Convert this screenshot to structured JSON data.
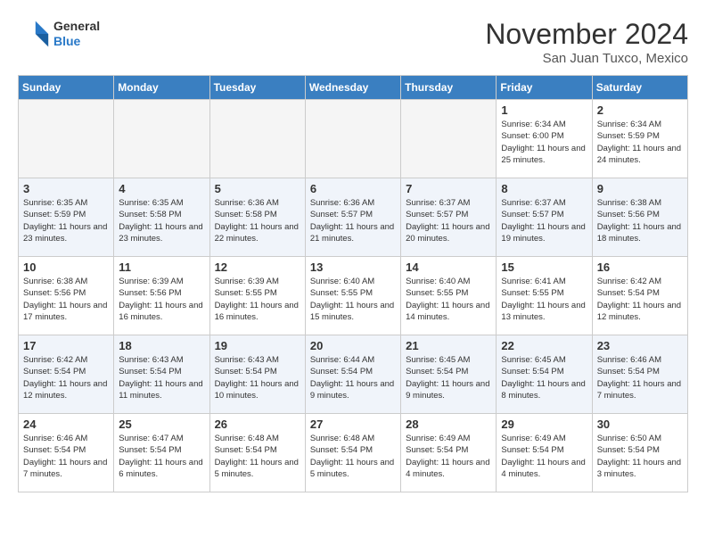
{
  "header": {
    "logo_general": "General",
    "logo_blue": "Blue",
    "month_title": "November 2024",
    "location": "San Juan Tuxco, Mexico"
  },
  "weekdays": [
    "Sunday",
    "Monday",
    "Tuesday",
    "Wednesday",
    "Thursday",
    "Friday",
    "Saturday"
  ],
  "weeks": [
    [
      {
        "day": "",
        "info": ""
      },
      {
        "day": "",
        "info": ""
      },
      {
        "day": "",
        "info": ""
      },
      {
        "day": "",
        "info": ""
      },
      {
        "day": "",
        "info": ""
      },
      {
        "day": "1",
        "info": "Sunrise: 6:34 AM\nSunset: 6:00 PM\nDaylight: 11 hours and 25 minutes."
      },
      {
        "day": "2",
        "info": "Sunrise: 6:34 AM\nSunset: 5:59 PM\nDaylight: 11 hours and 24 minutes."
      }
    ],
    [
      {
        "day": "3",
        "info": "Sunrise: 6:35 AM\nSunset: 5:59 PM\nDaylight: 11 hours and 23 minutes."
      },
      {
        "day": "4",
        "info": "Sunrise: 6:35 AM\nSunset: 5:58 PM\nDaylight: 11 hours and 23 minutes."
      },
      {
        "day": "5",
        "info": "Sunrise: 6:36 AM\nSunset: 5:58 PM\nDaylight: 11 hours and 22 minutes."
      },
      {
        "day": "6",
        "info": "Sunrise: 6:36 AM\nSunset: 5:57 PM\nDaylight: 11 hours and 21 minutes."
      },
      {
        "day": "7",
        "info": "Sunrise: 6:37 AM\nSunset: 5:57 PM\nDaylight: 11 hours and 20 minutes."
      },
      {
        "day": "8",
        "info": "Sunrise: 6:37 AM\nSunset: 5:57 PM\nDaylight: 11 hours and 19 minutes."
      },
      {
        "day": "9",
        "info": "Sunrise: 6:38 AM\nSunset: 5:56 PM\nDaylight: 11 hours and 18 minutes."
      }
    ],
    [
      {
        "day": "10",
        "info": "Sunrise: 6:38 AM\nSunset: 5:56 PM\nDaylight: 11 hours and 17 minutes."
      },
      {
        "day": "11",
        "info": "Sunrise: 6:39 AM\nSunset: 5:56 PM\nDaylight: 11 hours and 16 minutes."
      },
      {
        "day": "12",
        "info": "Sunrise: 6:39 AM\nSunset: 5:55 PM\nDaylight: 11 hours and 16 minutes."
      },
      {
        "day": "13",
        "info": "Sunrise: 6:40 AM\nSunset: 5:55 PM\nDaylight: 11 hours and 15 minutes."
      },
      {
        "day": "14",
        "info": "Sunrise: 6:40 AM\nSunset: 5:55 PM\nDaylight: 11 hours and 14 minutes."
      },
      {
        "day": "15",
        "info": "Sunrise: 6:41 AM\nSunset: 5:55 PM\nDaylight: 11 hours and 13 minutes."
      },
      {
        "day": "16",
        "info": "Sunrise: 6:42 AM\nSunset: 5:54 PM\nDaylight: 11 hours and 12 minutes."
      }
    ],
    [
      {
        "day": "17",
        "info": "Sunrise: 6:42 AM\nSunset: 5:54 PM\nDaylight: 11 hours and 12 minutes."
      },
      {
        "day": "18",
        "info": "Sunrise: 6:43 AM\nSunset: 5:54 PM\nDaylight: 11 hours and 11 minutes."
      },
      {
        "day": "19",
        "info": "Sunrise: 6:43 AM\nSunset: 5:54 PM\nDaylight: 11 hours and 10 minutes."
      },
      {
        "day": "20",
        "info": "Sunrise: 6:44 AM\nSunset: 5:54 PM\nDaylight: 11 hours and 9 minutes."
      },
      {
        "day": "21",
        "info": "Sunrise: 6:45 AM\nSunset: 5:54 PM\nDaylight: 11 hours and 9 minutes."
      },
      {
        "day": "22",
        "info": "Sunrise: 6:45 AM\nSunset: 5:54 PM\nDaylight: 11 hours and 8 minutes."
      },
      {
        "day": "23",
        "info": "Sunrise: 6:46 AM\nSunset: 5:54 PM\nDaylight: 11 hours and 7 minutes."
      }
    ],
    [
      {
        "day": "24",
        "info": "Sunrise: 6:46 AM\nSunset: 5:54 PM\nDaylight: 11 hours and 7 minutes."
      },
      {
        "day": "25",
        "info": "Sunrise: 6:47 AM\nSunset: 5:54 PM\nDaylight: 11 hours and 6 minutes."
      },
      {
        "day": "26",
        "info": "Sunrise: 6:48 AM\nSunset: 5:54 PM\nDaylight: 11 hours and 5 minutes."
      },
      {
        "day": "27",
        "info": "Sunrise: 6:48 AM\nSunset: 5:54 PM\nDaylight: 11 hours and 5 minutes."
      },
      {
        "day": "28",
        "info": "Sunrise: 6:49 AM\nSunset: 5:54 PM\nDaylight: 11 hours and 4 minutes."
      },
      {
        "day": "29",
        "info": "Sunrise: 6:49 AM\nSunset: 5:54 PM\nDaylight: 11 hours and 4 minutes."
      },
      {
        "day": "30",
        "info": "Sunrise: 6:50 AM\nSunset: 5:54 PM\nDaylight: 11 hours and 3 minutes."
      }
    ]
  ]
}
